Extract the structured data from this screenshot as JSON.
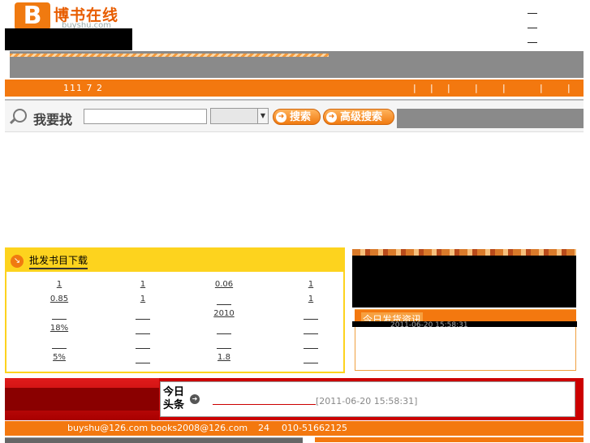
{
  "header": {
    "logo_letter": "B",
    "logo_name": "博书在线",
    "logo_domain": "buyshu.com"
  },
  "orange_bar": {
    "numbers": "111 7 2",
    "separators": [
      "|",
      "|",
      "|",
      "|",
      "|",
      "|",
      "|"
    ]
  },
  "search": {
    "label": "我要找",
    "input_value": "",
    "select_value": "",
    "search_button": "搜索",
    "advanced_button": "高级搜索"
  },
  "wholesale": {
    "title": "批发书目下载",
    "rows": [
      [
        "1",
        "1",
        "0.06",
        "1"
      ],
      [
        "0.85",
        "1",
        "",
        "1"
      ],
      [
        "",
        "",
        "2010",
        ""
      ],
      [
        "18%",
        "",
        "",
        ""
      ],
      [
        "",
        "",
        "",
        ""
      ],
      [
        "5%",
        "",
        "1.8",
        ""
      ]
    ]
  },
  "shipping": {
    "title": "今日发货资讯",
    "faint_text": "2011-06-20 15:58:31"
  },
  "headline": {
    "label": "今日头条",
    "date": "[2011-06-20 15:58:31]"
  },
  "footer": {
    "emails": "buyshu@126.com books2008@126.com",
    "hours": "24",
    "phone": "010-51662125"
  },
  "icons": {
    "search": "magnifier-icon",
    "arrow": "arrow-right-icon"
  },
  "colors": {
    "accent_orange": "#f3780f",
    "panel_yellow": "#fdd31e",
    "news_red": "#cc0000"
  }
}
